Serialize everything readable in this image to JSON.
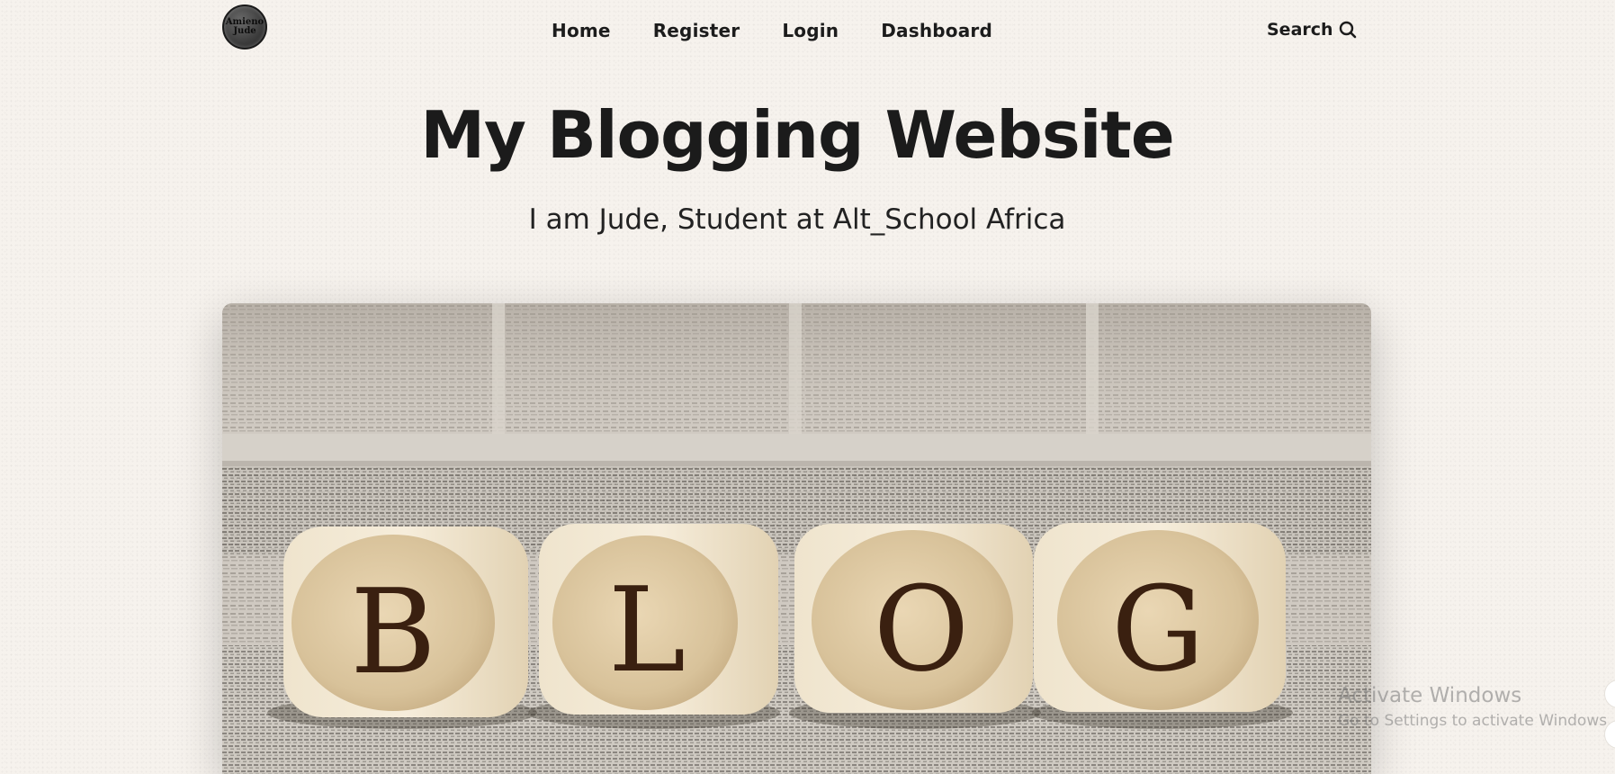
{
  "logo": {
    "line1": "Amieno",
    "line2": "Jude"
  },
  "nav": {
    "items": [
      {
        "label": "Home"
      },
      {
        "label": "Register"
      },
      {
        "label": "Login"
      },
      {
        "label": "Dashboard"
      }
    ]
  },
  "search": {
    "label": "Search",
    "icon": "search-icon"
  },
  "hero": {
    "title": "My Blogging Website",
    "subtitle": "I am Jude, Student at Alt_School Africa"
  },
  "banner": {
    "letters": [
      "B",
      "L",
      "O",
      "G"
    ]
  },
  "watermark": {
    "title": "Activate Windows",
    "subtitle": "Go to Settings to activate Windows."
  }
}
